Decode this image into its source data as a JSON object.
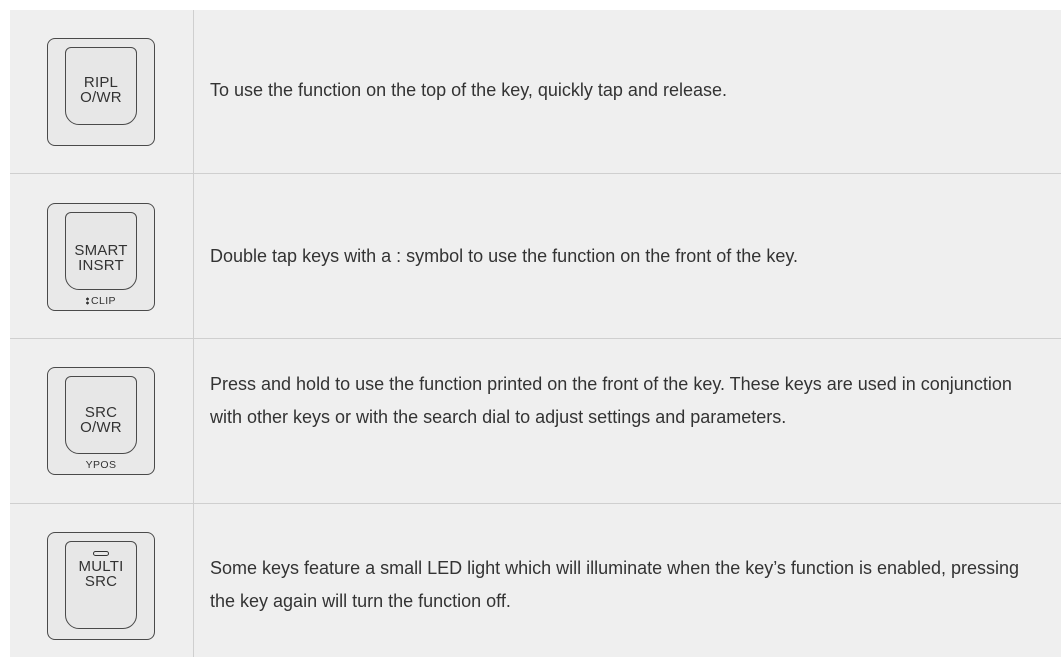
{
  "rows": [
    {
      "key_top": [
        "RIPL",
        "O/WR"
      ],
      "key_front": "",
      "description": "To use the function on the top of the key, quickly tap and release."
    },
    {
      "key_top": [
        "SMART",
        "INSRT"
      ],
      "key_front": "CLIP",
      "front_icon": "double-tap-dots-icon",
      "description": "Double tap keys with a : symbol to use the function on the front of the key."
    },
    {
      "key_top": [
        "SRC",
        "O/WR"
      ],
      "key_front": "YPOS",
      "description": "Press and hold to use the function printed on the front of the key. These keys are used in conjunction with other keys or with the search dial to adjust settings and parameters."
    },
    {
      "key_top": [
        "MULTI",
        "SRC"
      ],
      "key_front": "",
      "top_icon": "led-light-icon",
      "description": "Some keys feature a small LED light which will illuminate when the key’s function is enabled, pressing the key again will turn the function off."
    }
  ]
}
